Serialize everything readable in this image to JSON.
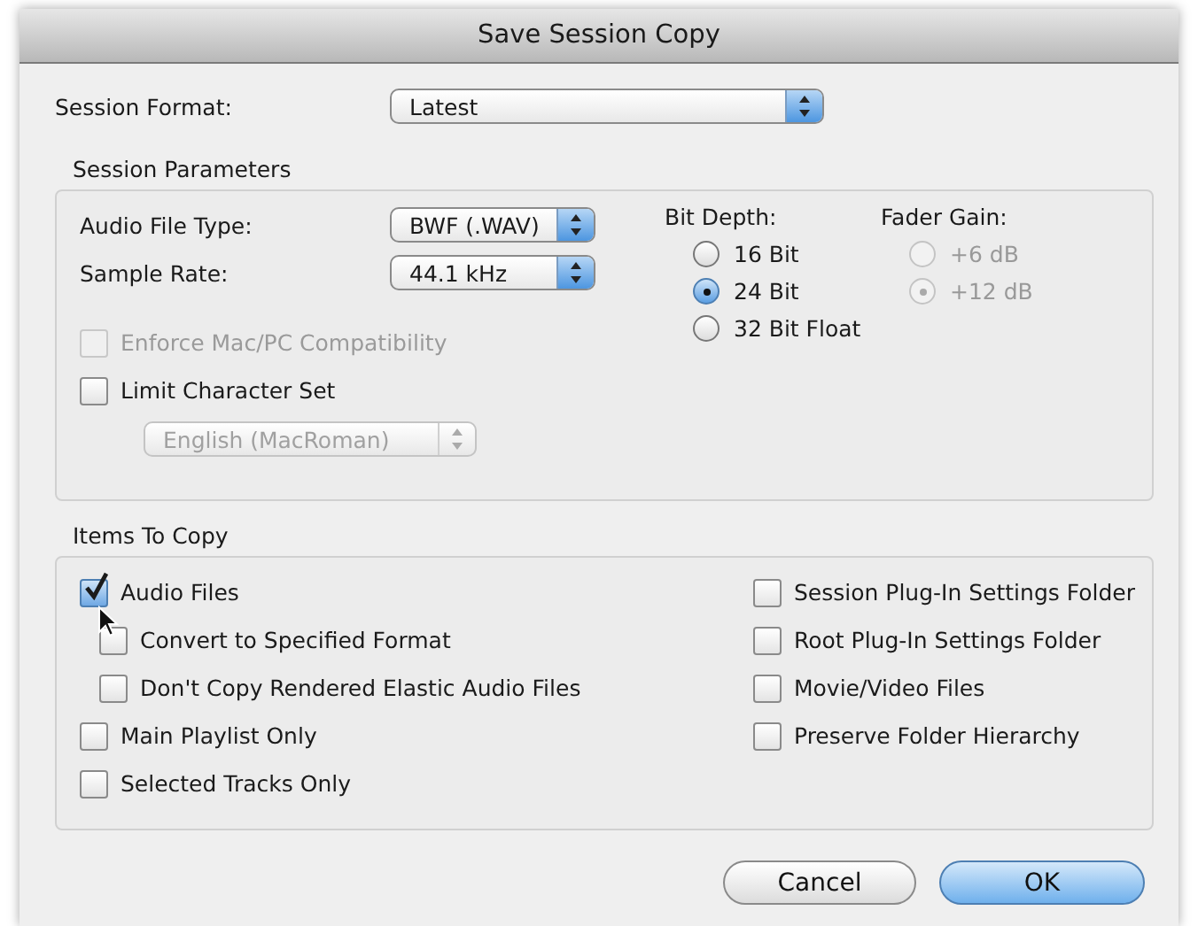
{
  "window": {
    "title": "Save Session Copy"
  },
  "session_format": {
    "label": "Session Format:",
    "value": "Latest"
  },
  "session_parameters": {
    "title": "Session Parameters",
    "popups": [
      {
        "label": "Audio File Type:",
        "value": "BWF (.WAV)"
      },
      {
        "label": "Sample Rate:",
        "value": "44.1 kHz"
      }
    ],
    "checkboxes": [
      {
        "label": "Enforce Mac/PC Compatibility",
        "checked": false,
        "disabled": true
      },
      {
        "label": "Limit Character Set",
        "checked": false,
        "disabled": false
      }
    ],
    "character_set": {
      "value": "English (MacRoman)",
      "disabled": true
    },
    "bit_depth": {
      "label": "Bit Depth:",
      "options": [
        {
          "label": "16 Bit",
          "selected": false,
          "disabled": false
        },
        {
          "label": "24 Bit",
          "selected": true,
          "disabled": false
        },
        {
          "label": "32 Bit Float",
          "selected": false,
          "disabled": false
        }
      ]
    },
    "fader_gain": {
      "label": "Fader Gain:",
      "options": [
        {
          "label": "+6 dB",
          "selected": false,
          "disabled": true
        },
        {
          "label": "+12 dB",
          "selected": true,
          "disabled": true
        }
      ]
    }
  },
  "items_to_copy": {
    "title": "Items To Copy",
    "left": [
      {
        "label": "Audio Files",
        "checked": true,
        "children": [
          {
            "label": "Convert to Specified Format",
            "checked": false
          },
          {
            "label": "Don't Copy Rendered Elastic Audio Files",
            "checked": false
          }
        ]
      },
      {
        "label": "Main Playlist Only",
        "checked": false
      },
      {
        "label": "Selected Tracks Only",
        "checked": false
      }
    ],
    "right": [
      {
        "label": "Session Plug-In Settings Folder",
        "checked": false
      },
      {
        "label": "Root Plug-In Settings Folder",
        "checked": false
      },
      {
        "label": "Movie/Video Files",
        "checked": false
      },
      {
        "label": "Preserve Folder Hierarchy",
        "checked": false
      }
    ]
  },
  "buttons": [
    {
      "label": "Cancel",
      "default": false
    },
    {
      "label": "OK",
      "default": true
    }
  ]
}
